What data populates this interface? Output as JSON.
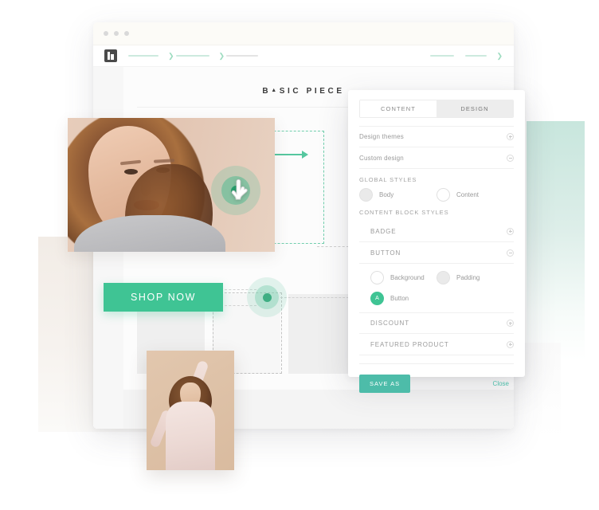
{
  "browser": {
    "dots": 3,
    "logo_icon": "app-logo-icon",
    "nav_items": [
      "nav-line-1",
      "nav-line-2",
      "nav-line-3",
      "nav-line-4",
      "nav-line-5"
    ]
  },
  "site": {
    "title_left": "B",
    "title_mark": "▲",
    "title_right": "SIC PIECE",
    "shop_now_label": "SHOP NOW"
  },
  "panel": {
    "tabs": [
      {
        "label": "CONTENT",
        "active": false
      },
      {
        "label": "DESIGN",
        "active": true
      }
    ],
    "rows": [
      {
        "label": "Design themes",
        "toggle": "plus"
      },
      {
        "label": "Custom design",
        "toggle": "minus"
      }
    ],
    "global_styles": {
      "section_label": "GLOBAL STYLES",
      "swatches": [
        {
          "label": "Body",
          "state": "filled"
        },
        {
          "label": "Content",
          "state": "outline"
        }
      ]
    },
    "content_block_styles": {
      "section_label": "CONTENT BLOCK STYLES",
      "items": [
        {
          "label": "BADGE",
          "toggle": "plus"
        },
        {
          "label": "BUTTON",
          "toggle": "minus"
        },
        {
          "label": "DISCOUNT",
          "toggle": "plus"
        },
        {
          "label": "FEATURED PRODUCT",
          "toggle": "plus"
        }
      ],
      "button_swatches": [
        {
          "label": "Background",
          "state": "outline",
          "glyph": ""
        },
        {
          "label": "Padding",
          "state": "filled",
          "glyph": ""
        },
        {
          "label": "Button",
          "state": "green",
          "glyph": "A"
        }
      ]
    },
    "footer": {
      "save_label": "SAVE AS",
      "close_label": "Close"
    }
  },
  "colors": {
    "accent_green": "#3fc494",
    "save_teal": "#4dbca9",
    "target_core": "#28a06e",
    "selection_dash": "#72cfae",
    "mint_block": "#c8e6dd",
    "beige_block": "#f2ece6"
  }
}
